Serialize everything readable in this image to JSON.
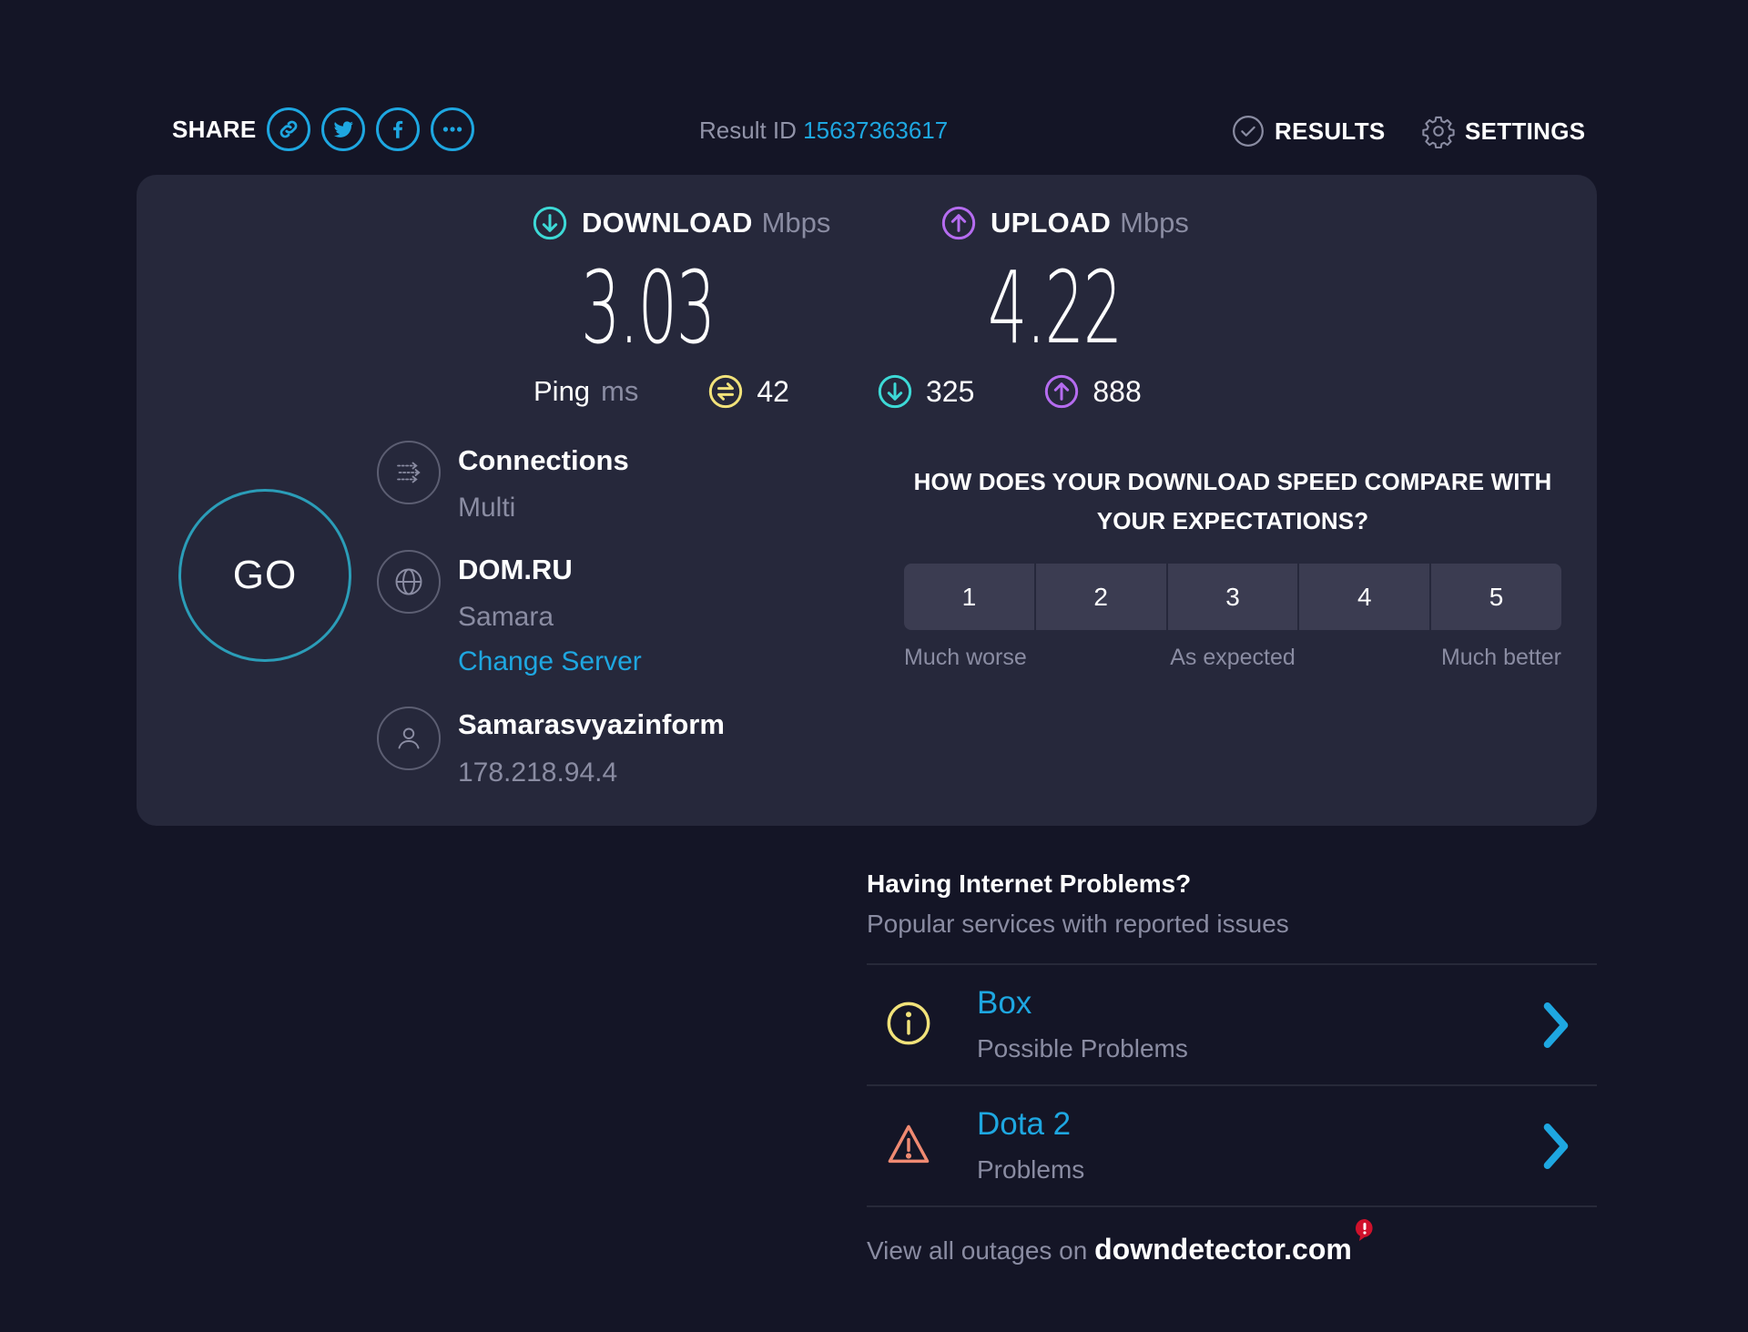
{
  "header": {
    "share_label": "SHARE",
    "share_buttons": [
      {
        "icon": "link-icon"
      },
      {
        "icon": "twitter-icon"
      },
      {
        "icon": "facebook-icon"
      },
      {
        "icon": "more-icon"
      }
    ],
    "result_id_label": "Result ID",
    "result_id": "15637363617",
    "nav": {
      "results_label": "RESULTS",
      "settings_label": "SETTINGS"
    }
  },
  "speeds": {
    "download": {
      "label": "DOWNLOAD",
      "unit": "Mbps",
      "value": "3.03",
      "color": "#3dd9d6"
    },
    "upload": {
      "label": "UPLOAD",
      "unit": "Mbps",
      "value": "4.22",
      "color": "#b56cf0"
    }
  },
  "ping": {
    "label": "Ping",
    "unit": "ms",
    "idle": {
      "value": "42",
      "color": "#f1e27a"
    },
    "download": {
      "value": "325",
      "color": "#3dd9d6"
    },
    "upload": {
      "value": "888",
      "color": "#b56cf0"
    }
  },
  "go_label": "GO",
  "connections": {
    "title": "Connections",
    "value": "Multi"
  },
  "server": {
    "name": "DOM.RU",
    "location": "Samara",
    "change_label": "Change Server"
  },
  "isp": {
    "name": "Samarasvyazinform",
    "ip": "178.218.94.4"
  },
  "rating": {
    "question": "HOW DOES YOUR DOWNLOAD SPEED COMPARE WITH YOUR EXPECTATIONS?",
    "options": [
      "1",
      "2",
      "3",
      "4",
      "5"
    ],
    "labels": {
      "low": "Much worse",
      "mid": "As expected",
      "high": "Much better"
    }
  },
  "problems": {
    "title": "Having Internet Problems?",
    "subtitle": "Popular services with reported issues",
    "items": [
      {
        "name": "Box",
        "status": "Possible Problems",
        "icon": "info-icon",
        "icon_color": "#f1e27a"
      },
      {
        "name": "Dota 2",
        "status": "Problems",
        "icon": "warning-icon",
        "icon_color": "#f08a72"
      }
    ],
    "footer_prefix": "View all outages on",
    "footer_link": "downdetector.com"
  },
  "colors": {
    "accent": "#1ea7e1",
    "background": "#141526",
    "card": "#26283b"
  }
}
